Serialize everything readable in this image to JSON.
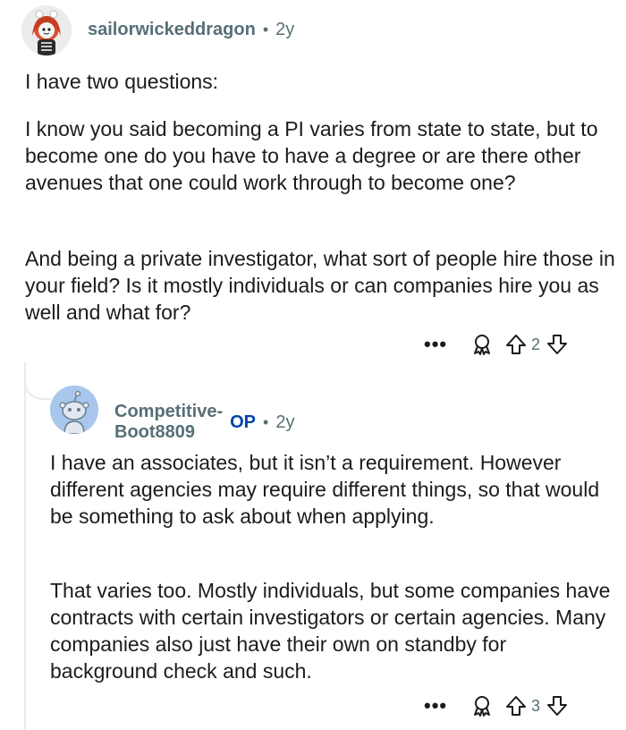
{
  "parent_comment": {
    "username": "sailorwickeddragon",
    "age": "2y",
    "paragraphs": [
      "I have two questions:",
      "I know you said becoming a PI varies from state to state, but to become one do you have to have a degree or are there other avenues that one could work through to become one?",
      "And being a private investigator, what sort of people hire those in your field? Is it mostly individuals or can companies hire you as well and what for?"
    ],
    "more_label": "•••",
    "score": "2",
    "icons": {
      "avatar": "avatar-icon",
      "award": "award-icon",
      "upvote": "upvote-arrow-icon",
      "downvote": "downvote-arrow-icon"
    }
  },
  "reply_comment": {
    "username": "Competitive-Boot8809",
    "op_badge": "OP",
    "age": "2y",
    "paragraphs": [
      "I have an associates, but it isn’t a requirement. However different agencies may require different things, so that would be something to ask about when applying.",
      "That varies too. Mostly individuals, but some companies have contracts  with certain  investigators or certain  agencies. Many companies also just have their own on standby for background check and such."
    ],
    "more_label": "•••",
    "score": "3",
    "icons": {
      "avatar": "snoo-avatar-icon",
      "award": "award-icon",
      "upvote": "upvote-arrow-icon",
      "downvote": "downvote-arrow-icon"
    }
  },
  "separator": "•",
  "colors": {
    "meta": "#576f76",
    "op": "#0045ac",
    "text": "#1c1c1c",
    "thread": "#e5ebee",
    "avatar_bg": "#a9c7ec"
  }
}
